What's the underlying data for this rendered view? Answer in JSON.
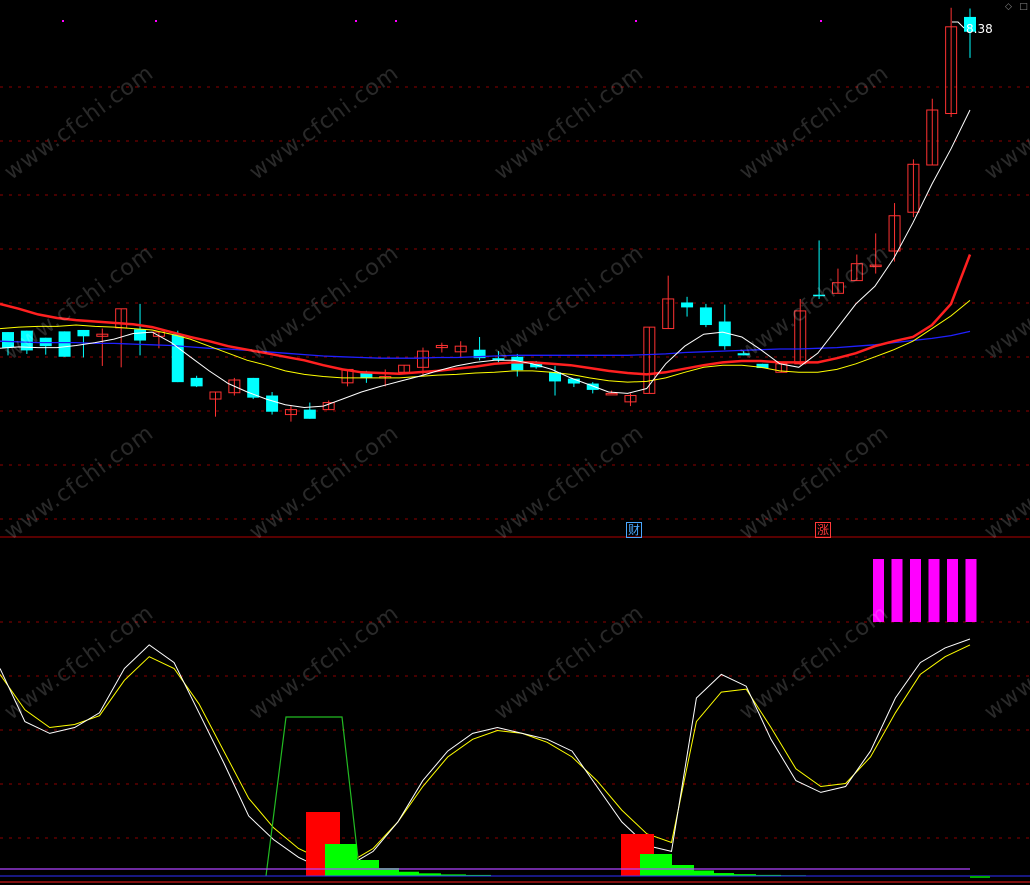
{
  "window": {
    "buttons": [
      "◇",
      "□"
    ],
    "watermark": "www.cfchi.com"
  },
  "signals": {
    "cai": "财",
    "zhang": "涨"
  },
  "colors": {
    "background": "#000000",
    "up_candle": "#ff3232",
    "down_candle": "#00ffff",
    "ma_short": "#ffffff",
    "ma_mid": "#ffff00",
    "ma_red": "#ff2020",
    "ma_blue": "#2020ff",
    "grid": "#8b0000",
    "pink_bars": "#ff00ff",
    "red_hist": "#ff0000",
    "green_hist": "#00ff00"
  },
  "chart_data": [
    {
      "type": "candlestick",
      "title": "",
      "max_price_label": "8.38",
      "grid": true,
      "candles": [
        {
          "o": 85,
          "h": 75,
          "l": 52,
          "c": 63
        },
        {
          "o": 87,
          "h": 65,
          "l": 54,
          "c": 59
        },
        {
          "o": 77,
          "h": 73,
          "l": 53,
          "c": 65
        },
        {
          "o": 86,
          "h": 84,
          "l": 50,
          "c": 50
        },
        {
          "o": 88,
          "h": 82,
          "l": 49,
          "c": 79
        },
        {
          "o": 79,
          "h": 90,
          "l": 37,
          "c": 82
        },
        {
          "o": 91,
          "h": 101,
          "l": 35,
          "c": 118
        },
        {
          "o": 89,
          "h": 125,
          "l": 52,
          "c": 73
        },
        {
          "o": 79,
          "h": 72,
          "l": 62,
          "c": 85
        },
        {
          "o": 82,
          "h": 87,
          "l": 40,
          "c": 14
        },
        {
          "o": 20,
          "h": 23,
          "l": 7,
          "c": 8
        },
        {
          "o": -10,
          "h": 0,
          "l": -35,
          "c": 0
        },
        {
          "o": -1,
          "h": 20,
          "l": -5,
          "c": 17
        },
        {
          "o": 20,
          "h": 0,
          "l": -10,
          "c": -8
        },
        {
          "o": -5,
          "h": 0,
          "l": -32,
          "c": -28
        },
        {
          "o": -32,
          "h": -20,
          "l": -42,
          "c": -25
        },
        {
          "o": -25,
          "h": -15,
          "l": -32,
          "c": -38
        },
        {
          "o": -25,
          "h": -12,
          "l": -20,
          "c": -15
        },
        {
          "o": 13,
          "h": 26,
          "l": 8,
          "c": 32
        },
        {
          "o": 27,
          "h": 30,
          "l": 13,
          "c": 20
        },
        {
          "o": 21,
          "h": 32,
          "l": 8,
          "c": 22
        },
        {
          "o": 28,
          "h": 35,
          "l": 25,
          "c": 38
        },
        {
          "o": 35,
          "h": 63,
          "l": 24,
          "c": 58
        },
        {
          "o": 63,
          "h": 70,
          "l": 56,
          "c": 66
        },
        {
          "o": 57,
          "h": 72,
          "l": 48,
          "c": 65
        },
        {
          "o": 60,
          "h": 78,
          "l": 45,
          "c": 48
        },
        {
          "o": 48,
          "h": 58,
          "l": 42,
          "c": 45
        },
        {
          "o": 50,
          "h": 54,
          "l": 22,
          "c": 31
        },
        {
          "o": 40,
          "h": 44,
          "l": 33,
          "c": 35
        },
        {
          "o": 28,
          "h": 37,
          "l": -5,
          "c": 15
        },
        {
          "o": 19,
          "h": 19,
          "l": 7,
          "c": 12
        },
        {
          "o": 12,
          "h": 14,
          "l": -2,
          "c": 3
        },
        {
          "o": -2,
          "h": 2,
          "l": -2,
          "c": -2
        },
        {
          "o": -14,
          "h": -2,
          "l": -20,
          "c": -5
        },
        {
          "o": -2,
          "h": 92,
          "l": 0,
          "c": 92
        },
        {
          "o": 90,
          "h": 165,
          "l": 92,
          "c": 132
        },
        {
          "o": 127,
          "h": 135,
          "l": 107,
          "c": 120
        },
        {
          "o": 120,
          "h": 125,
          "l": 92,
          "c": 95
        },
        {
          "o": 100,
          "h": 124,
          "l": 60,
          "c": 65
        },
        {
          "o": 55,
          "h": 58,
          "l": 52,
          "c": 52
        },
        {
          "o": 40,
          "h": 40,
          "l": 35,
          "c": 34
        },
        {
          "o": 28,
          "h": 40,
          "l": 32,
          "c": 40
        },
        {
          "o": 40,
          "h": 132,
          "l": 38,
          "c": 115
        },
        {
          "o": 138,
          "h": 215,
          "l": 132,
          "c": 136
        },
        {
          "o": 140,
          "h": 175,
          "l": 143,
          "c": 155
        },
        {
          "o": 158,
          "h": 195,
          "l": 158,
          "c": 182
        },
        {
          "o": 180,
          "h": 225,
          "l": 168,
          "c": 180
        },
        {
          "o": 200,
          "h": 268,
          "l": 185,
          "c": 250
        },
        {
          "o": 255,
          "h": 330,
          "l": 248,
          "c": 323
        },
        {
          "o": 322,
          "h": 416,
          "l": 325,
          "c": 400
        },
        {
          "o": 395,
          "h": 545,
          "l": 390,
          "c": 518
        },
        {
          "o": 532,
          "h": 544,
          "l": 474,
          "c": 511
        }
      ],
      "ma_short": [
        62,
        64,
        63,
        63,
        66,
        70,
        75,
        83,
        85,
        70,
        50,
        30,
        12,
        0,
        -10,
        -18,
        -22,
        -20,
        -10,
        0,
        8,
        15,
        22,
        30,
        37,
        42,
        45,
        45,
        40,
        32,
        20,
        10,
        0,
        -2,
        5,
        40,
        65,
        82,
        85,
        78,
        60,
        40,
        35,
        55,
        90,
        125,
        150,
        190,
        240,
        295,
        345,
        400
      ],
      "ma_mid": [
        90,
        92,
        93,
        93,
        95,
        93,
        92,
        90,
        88,
        82,
        75,
        65,
        55,
        45,
        38,
        30,
        25,
        22,
        20,
        20,
        20,
        20,
        22,
        24,
        25,
        27,
        28,
        30,
        30,
        28,
        25,
        20,
        16,
        14,
        15,
        20,
        28,
        35,
        38,
        38,
        35,
        30,
        28,
        28,
        32,
        40,
        50,
        60,
        72,
        90,
        108,
        130
      ],
      "ma_red": [
        125,
        118,
        110,
        105,
        102,
        100,
        98,
        96,
        92,
        85,
        78,
        72,
        65,
        60,
        55,
        50,
        45,
        38,
        32,
        28,
        27,
        26,
        28,
        30,
        33,
        36,
        40,
        42,
        42,
        40,
        38,
        34,
        30,
        27,
        25,
        28,
        33,
        38,
        42,
        44,
        44,
        42,
        42,
        42,
        48,
        55,
        65,
        72,
        78,
        95,
        125,
        195
      ],
      "ma_blue": [
        72,
        71,
        70,
        70,
        70,
        69,
        69,
        68,
        67,
        66,
        64,
        62,
        61,
        59,
        57,
        55,
        53,
        51,
        50,
        49,
        48,
        48,
        48,
        49,
        49,
        50,
        51,
        52,
        52,
        52,
        52,
        52,
        52,
        52,
        53,
        54,
        56,
        57,
        58,
        59,
        60,
        61,
        61,
        62,
        63,
        65,
        67,
        70,
        73,
        76,
        80,
        86
      ]
    },
    {
      "type": "line",
      "title": "",
      "ylim": [
        0,
        100
      ],
      "grid": true,
      "series": [
        {
          "values": [
            70,
            52,
            48,
            50,
            55,
            70,
            78,
            72,
            55,
            38,
            20,
            12,
            6,
            2,
            3,
            8,
            18,
            32,
            42,
            48,
            50,
            48,
            46,
            42,
            30,
            18,
            10,
            8,
            60,
            68,
            64,
            46,
            32,
            28,
            30,
            42,
            60,
            72,
            77,
            80
          ]
        },
        {
          "values": [
            68,
            56,
            50,
            51,
            54,
            66,
            74,
            70,
            58,
            42,
            26,
            16,
            9,
            5,
            4,
            9,
            18,
            30,
            40,
            46,
            49,
            48,
            45,
            40,
            32,
            22,
            14,
            11,
            52,
            62,
            63,
            50,
            36,
            30,
            31,
            40,
            55,
            68,
            74,
            78
          ]
        }
      ],
      "bars_pink": [
        1,
        1,
        1,
        1,
        1,
        1
      ],
      "hist_green_outline": [
        0,
        1,
        1,
        1,
        0
      ],
      "hist_red": [
        1,
        0.6
      ],
      "hist_green": [
        0.6,
        0.3,
        0.15,
        0.08,
        0.05,
        0.03,
        0.02
      ]
    }
  ]
}
